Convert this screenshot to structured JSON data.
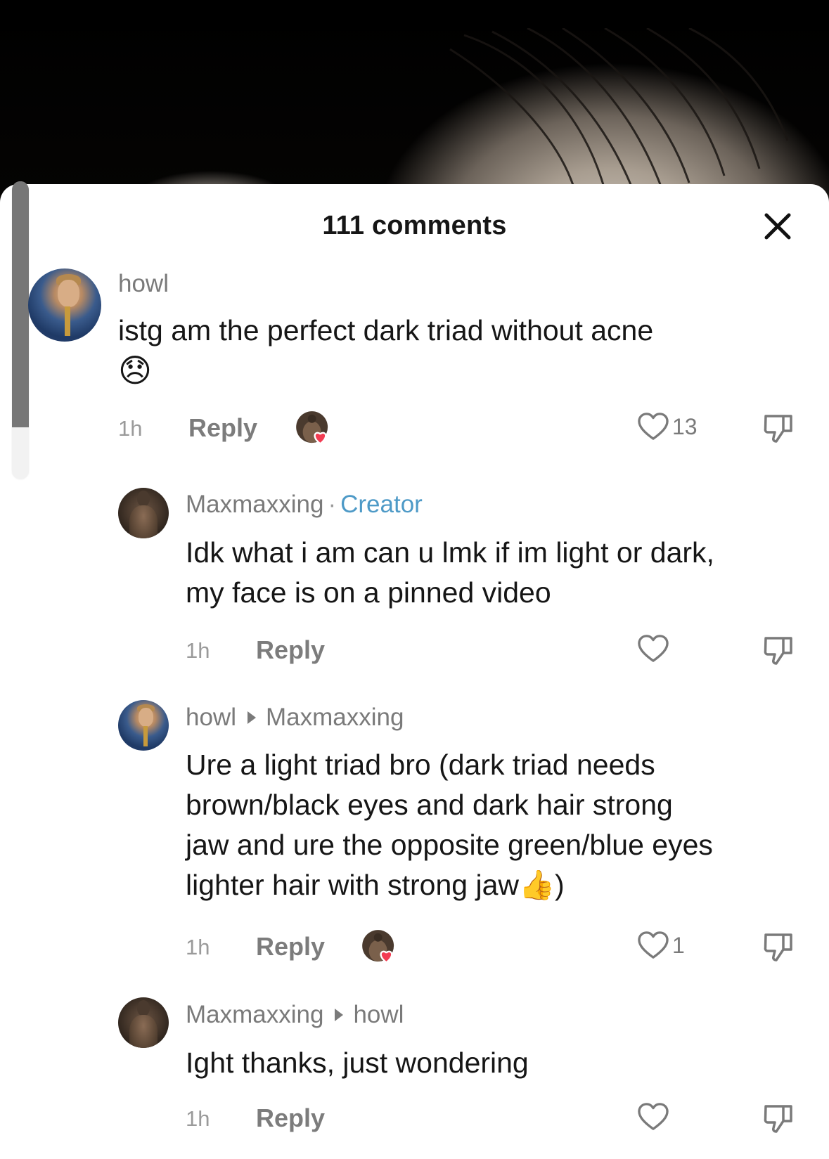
{
  "sheet": {
    "title": "111 comments"
  },
  "comments": [
    {
      "username": "howl",
      "text": "istg am the perfect dark triad without acne",
      "emoji": "😞",
      "time": "1h",
      "reply_label": "Reply",
      "likes": "13",
      "liked_by_creator": true
    },
    {
      "username": "Maxmaxxing",
      "badge": "Creator",
      "badge_separator": "·",
      "text_lines": [
        "Idk what i am can u lmk if im light or dark,",
        "my face is on a pinned video"
      ],
      "time": "1h",
      "reply_label": "Reply",
      "likes": "",
      "liked_by_creator": false
    },
    {
      "username": "howl",
      "reply_to": "Maxmaxxing",
      "text_lines": [
        "Ure a light triad bro (dark triad needs",
        "brown/black eyes and dark hair strong",
        "jaw and ure the opposite green/blue eyes",
        "lighter hair with strong jaw"
      ],
      "text_tail_emoji": "👍",
      "text_tail": ")",
      "time": "1h",
      "reply_label": "Reply",
      "likes": "1",
      "liked_by_creator": true
    },
    {
      "username": "Maxmaxxing",
      "reply_to": "howl",
      "text": "Ight thanks, just wondering",
      "time": "1h",
      "reply_label": "Reply",
      "likes": "",
      "liked_by_creator": false
    }
  ],
  "colors": {
    "creator_badge": "#4e9ac7",
    "like_heart_red": "#f23c52",
    "text_primary": "#161616",
    "text_secondary": "#7a7a7a"
  },
  "icons": {
    "close": "close-icon",
    "like": "heart-outline-icon",
    "dislike": "thumbs-down-icon",
    "creator_like": "creator-liked-avatar-icon"
  }
}
